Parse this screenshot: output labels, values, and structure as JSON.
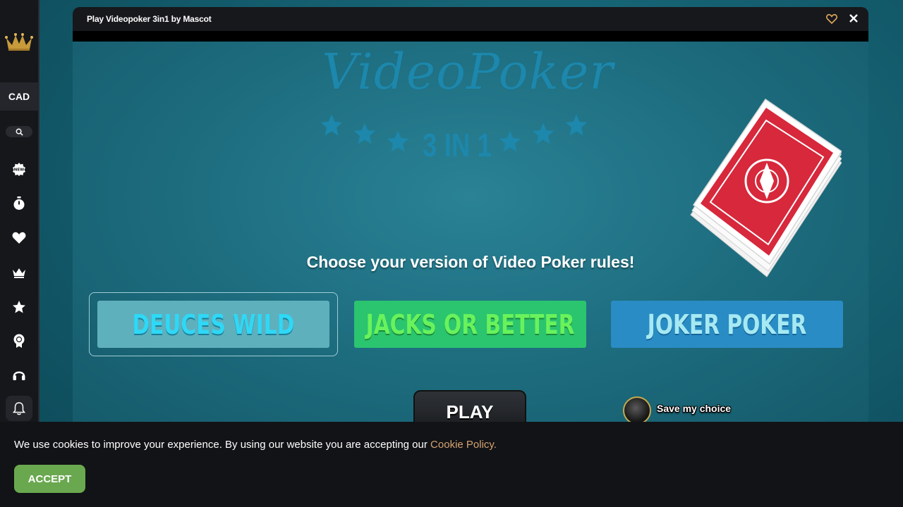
{
  "sidebar": {
    "logo_icon": "crown-logo-icon",
    "currency": "CAD",
    "search_icon": "search-icon",
    "nav": [
      {
        "name": "new-games",
        "icon": "new-badge-icon"
      },
      {
        "name": "recent",
        "icon": "stopwatch-icon"
      },
      {
        "name": "favorites",
        "icon": "heart-icon"
      },
      {
        "name": "vip",
        "icon": "crown-icon"
      },
      {
        "name": "top",
        "icon": "star-icon"
      },
      {
        "name": "tournaments",
        "icon": "award-icon"
      },
      {
        "name": "support",
        "icon": "headset-icon"
      }
    ],
    "notifications_icon": "bell-icon"
  },
  "game_window": {
    "title": "Play Videopoker 3in1 by Mascot",
    "favorite_icon": "heart-outline-icon",
    "close_icon": "close-icon",
    "logo_script": "VideoPoker",
    "logo_subtitle": "3 IN 1",
    "prompt": "Choose your version of Video Poker rules!",
    "options": [
      {
        "label": "DEUCES WILD",
        "selected": true
      },
      {
        "label": "JACKS OR BETTER",
        "selected": false
      },
      {
        "label": "JOKER POKER",
        "selected": false
      }
    ],
    "play_label": "PLAY",
    "save_choice_label": "Save my choice",
    "save_choice_checked": false
  },
  "cookie_banner": {
    "message": "We use cookies to improve your experience. By using our website you are accepting our",
    "policy_link": "Cookie Policy.",
    "accept_label": "ACCEPT"
  },
  "colors": {
    "accent_gold": "#d4a373",
    "accept_green": "#6aa84f",
    "sidebar_bg": "#16171b"
  }
}
